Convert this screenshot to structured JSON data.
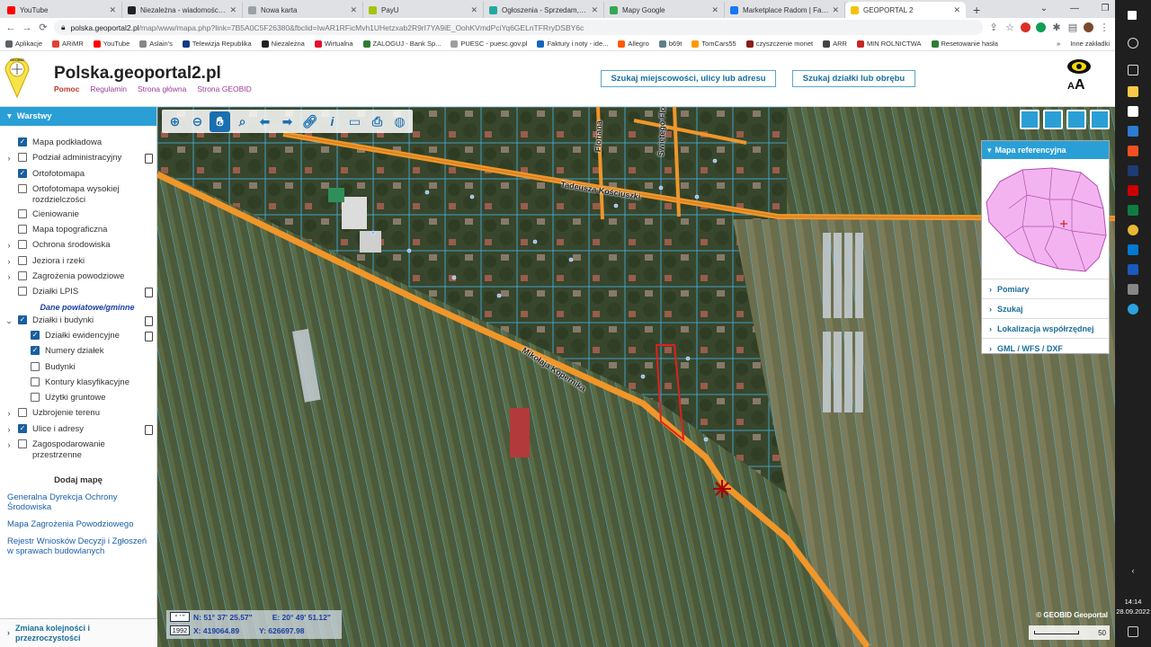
{
  "browser": {
    "tabs": [
      {
        "label": "YouTube",
        "color": "#ff0000"
      },
      {
        "label": "Niezależna - wiadomości | infor",
        "color": "#222222"
      },
      {
        "label": "Nowa karta",
        "color": "#9aa0a6"
      },
      {
        "label": "PayU",
        "color": "#a6c307"
      },
      {
        "label": "Ogłoszenia - Sprzedam, kupię n",
        "color": "#23a9a0"
      },
      {
        "label": "Mapy Google",
        "color": "#34a853"
      },
      {
        "label": "Marketplace Radom | Facebook",
        "color": "#1877f2"
      },
      {
        "label": "GEOPORTAL 2",
        "color": "#f4c20d",
        "active": true
      }
    ],
    "tab_close": "✕",
    "new_tab": "+",
    "window_controls": [
      "⌄",
      "—",
      "❐",
      "✕"
    ],
    "url_host": "polska.geoportal2.pl",
    "url_path": "/map/www/mapa.php?link=7B5A0C5F26380&fbclid=IwAR1RFicMvh1UHetzxab2R9rI7YA9iE_OohKVmdPciYq6GELnTFRryDSBY6c",
    "bookmarks": [
      {
        "label": "Aplikacje",
        "color": "#5f6368"
      },
      {
        "label": "ARiMR",
        "color": "#e34133"
      },
      {
        "label": "YouTube",
        "color": "#ff0000"
      },
      {
        "label": "Aslain's",
        "color": "#888888"
      },
      {
        "label": "Telewizja Republika",
        "color": "#123a8a"
      },
      {
        "label": "Niezależna",
        "color": "#222222"
      },
      {
        "label": "Wirtualna",
        "color": "#e3122b"
      },
      {
        "label": "ZALOGUJ - Bank Sp...",
        "color": "#2e7d32"
      },
      {
        "label": "PUESC - puesc.gov.pl",
        "color": "#9e9e9e"
      },
      {
        "label": "Faktury i noty - ide...",
        "color": "#1565c0"
      },
      {
        "label": "Allegro",
        "color": "#ff5a00"
      },
      {
        "label": "b69t",
        "color": "#607d8b"
      },
      {
        "label": "TomCars55",
        "color": "#ff9800"
      },
      {
        "label": "czyszczenie monet",
        "color": "#8d1c1c"
      },
      {
        "label": "ARR",
        "color": "#444444"
      },
      {
        "label": "MIN ROLNICTWA",
        "color": "#c62828"
      },
      {
        "label": "Resetowanie hasła",
        "color": "#2e7d32"
      }
    ],
    "bookmarks_more": "»",
    "other_bookmarks": "Inne zakładki"
  },
  "site": {
    "title": "Polska.geoportal2.pl",
    "logo_text": "GEOBID",
    "nav": [
      "Pomoc",
      "Regulamin",
      "Strona główna",
      "Strona GEOBID"
    ],
    "search_place_button": "Szukaj miejscowości, ulicy lub adresu",
    "search_parcel_button": "Szukaj działki lub obrębu",
    "font_size_label": "AA"
  },
  "layers_panel": {
    "header": "Warstwy",
    "items": [
      {
        "label": "Mapa podkładowa",
        "checked": true,
        "expander": "",
        "doc": false
      },
      {
        "label": "Podział administracyjny",
        "checked": false,
        "expander": "›",
        "doc": true
      },
      {
        "label": "Ortofotomapa",
        "checked": true,
        "expander": "",
        "doc": false
      },
      {
        "label": "Ortofotomapa wysokiej rozdzielczości",
        "checked": false,
        "expander": "",
        "doc": false
      },
      {
        "label": "Cieniowanie",
        "checked": false,
        "expander": "",
        "doc": false
      },
      {
        "label": "Mapa topograficzna",
        "checked": false,
        "expander": "",
        "doc": false
      },
      {
        "label": "Ochrona środowiska",
        "checked": false,
        "expander": "›",
        "doc": false
      },
      {
        "label": "Jeziora i rzeki",
        "checked": false,
        "expander": "›",
        "doc": false
      },
      {
        "label": "Zagrożenia powodziowe",
        "checked": false,
        "expander": "›",
        "doc": false
      },
      {
        "label": "Działki LPIS",
        "checked": false,
        "expander": "",
        "doc": true
      }
    ],
    "dane_label": "Dane powiatowe/gminne",
    "items2": [
      {
        "label": "Działki i budynki",
        "checked": true,
        "expander": "⌄",
        "doc": true,
        "sub": false
      },
      {
        "label": "Działki ewidencyjne",
        "checked": true,
        "expander": "",
        "doc": true,
        "sub": true
      },
      {
        "label": "Numery działek",
        "checked": true,
        "expander": "",
        "doc": false,
        "sub": true
      },
      {
        "label": "Budynki",
        "checked": false,
        "expander": "",
        "doc": false,
        "sub": true
      },
      {
        "label": "Kontury klasyfikacyjne",
        "checked": false,
        "expander": "",
        "doc": false,
        "sub": true
      },
      {
        "label": "Użytki gruntowe",
        "checked": false,
        "expander": "",
        "doc": false,
        "sub": true
      },
      {
        "label": "Uzbrojenie terenu",
        "checked": false,
        "expander": "›",
        "doc": false,
        "sub": false
      },
      {
        "label": "Ulice i adresy",
        "checked": true,
        "expander": "›",
        "doc": true,
        "sub": false
      },
      {
        "label": "Zagospodarowanie przestrzenne",
        "checked": false,
        "expander": "›",
        "doc": false,
        "sub": false
      }
    ],
    "add_map_title": "Dodaj mapę",
    "add_map_links": [
      "Generalna Dyrekcja Ochrony Środowiska",
      "Mapa Zagrożenia Powodziowego",
      "Rejestr Wniosków Decyzji i Zgłoszeń w sprawach budowlanych"
    ],
    "footer": "Zmiana kolejności i przezroczystości"
  },
  "map": {
    "streets": [
      "Tadeusza Kościuszki",
      "Świętego Floriana",
      "Mikołaja Kopernika",
      "Floriana"
    ],
    "reference_panel": {
      "header": "Mapa referencyjna",
      "rows": [
        "Pomiary",
        "Szukaj",
        "Lokalizacja współrzędnej",
        "GML / WFS / DXF"
      ]
    },
    "coords": {
      "format_tag": "° ' \"",
      "system_tag": "1992",
      "n": "N: 51° 37' 25.57\"",
      "e": "E: 20° 49' 51.12\"",
      "x": "X: 419064.89",
      "y": "Y: 626697.98"
    },
    "scale_value": "50",
    "credit": "© GEOBID  Geoportal"
  },
  "taskbar": {
    "time": "14:14",
    "date": "28.09.2022"
  },
  "colors": {
    "accent": "#2a9fd6",
    "road": "#f0962a",
    "parcel": "#43b7f2",
    "selection": "#e02020"
  }
}
